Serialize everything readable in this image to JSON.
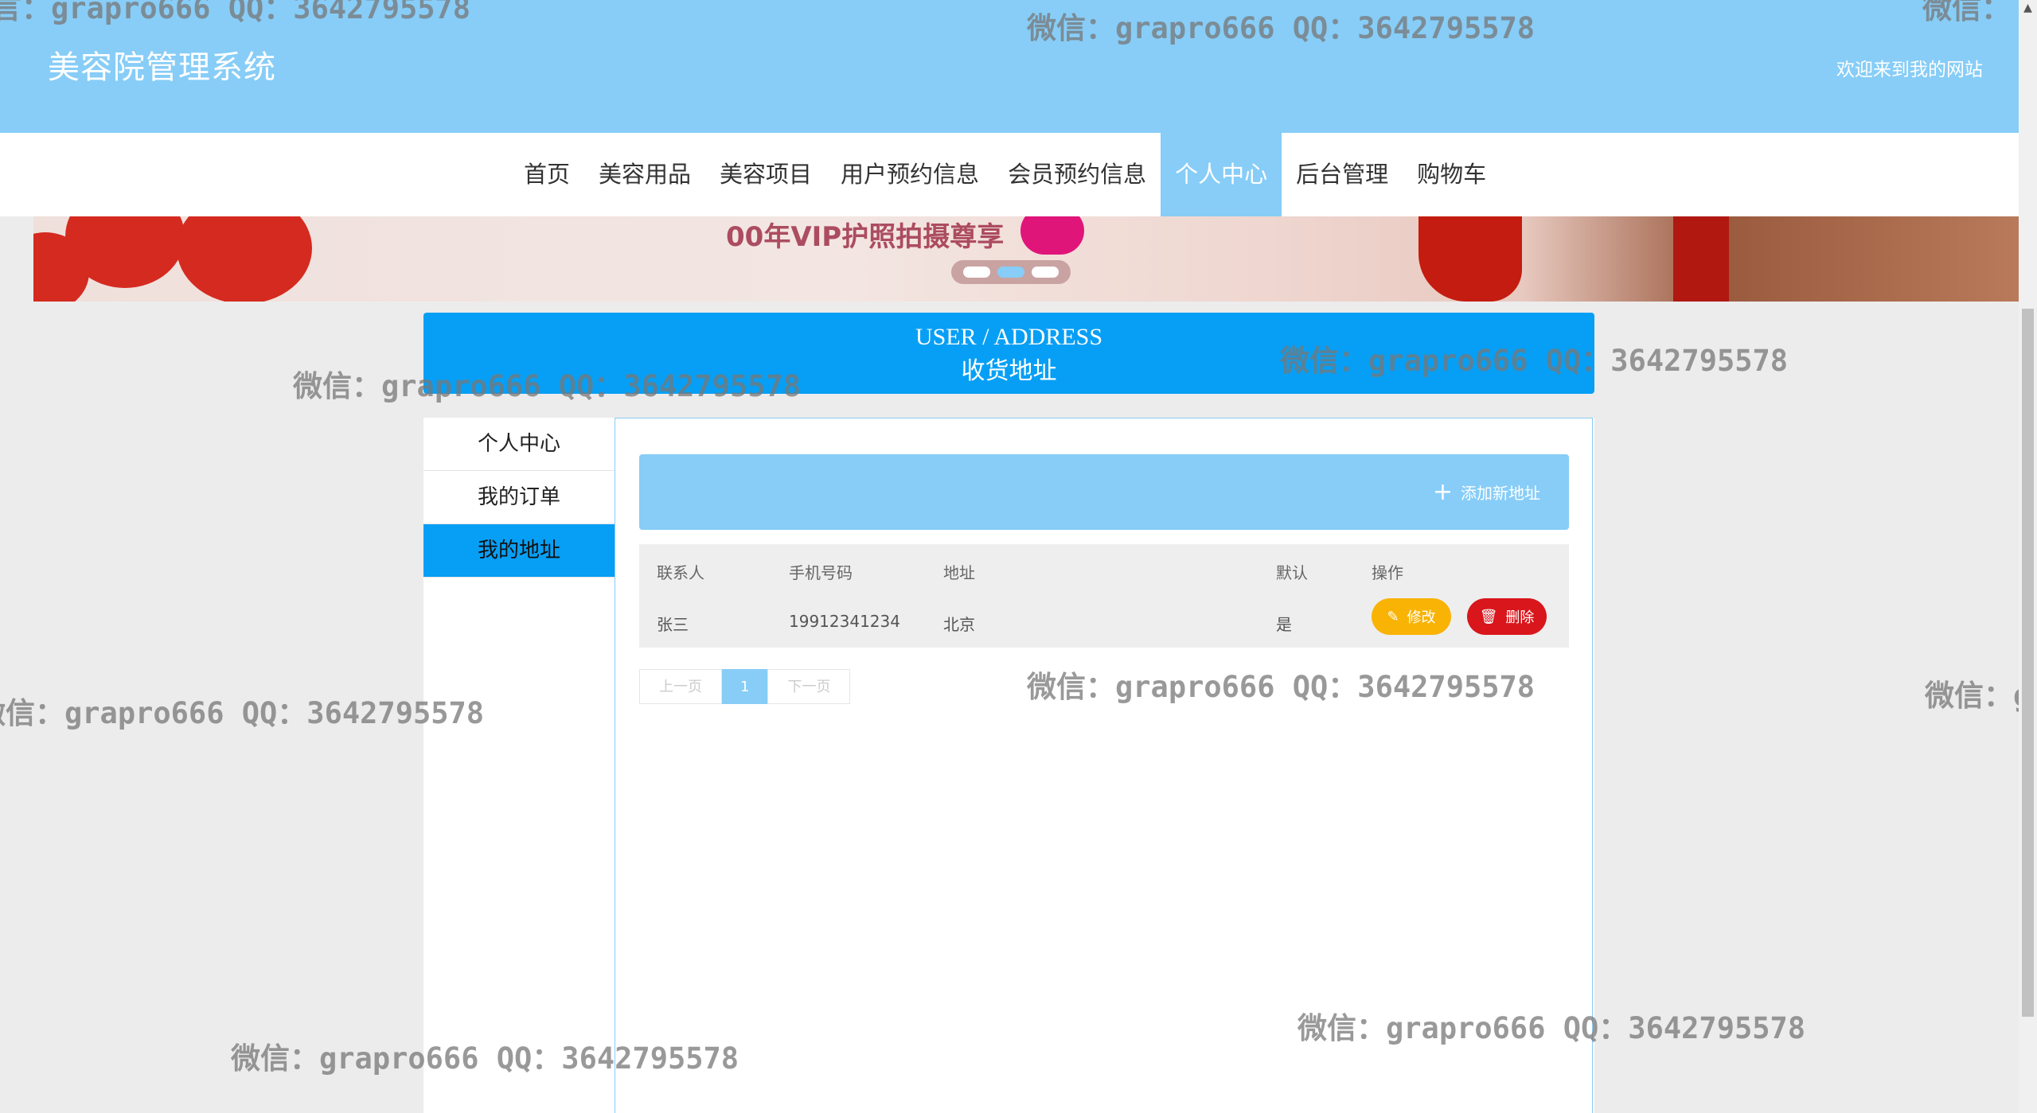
{
  "header": {
    "title": "美容院管理系统",
    "welcome": "欢迎来到我的网站"
  },
  "nav": {
    "items": [
      {
        "label": "首页"
      },
      {
        "label": "美容用品"
      },
      {
        "label": "美容项目"
      },
      {
        "label": "用户预约信息"
      },
      {
        "label": "会员预约信息"
      },
      {
        "label": "个人中心"
      },
      {
        "label": "后台管理"
      },
      {
        "label": "购物车"
      }
    ],
    "active": "个人中心"
  },
  "banner": {
    "text": "00年VIP护照拍摄尊享"
  },
  "section": {
    "title_en": "USER / ADDRESS",
    "title_cn": "收货地址"
  },
  "sidebar": {
    "items": [
      {
        "label": "个人中心"
      },
      {
        "label": "我的订单"
      },
      {
        "label": "我的地址"
      }
    ],
    "active": "我的地址"
  },
  "toolbar": {
    "add_label": "添加新地址"
  },
  "table": {
    "headers": [
      "联系人",
      "手机号码",
      "地址",
      "默认",
      "操作"
    ],
    "rows": [
      {
        "name": "张三",
        "phone": "19912341234",
        "address": "北京",
        "default": "是",
        "edit": "修改",
        "delete": "删除"
      }
    ]
  },
  "pager": {
    "prev": "上一页",
    "current": "1",
    "next": "下一页"
  },
  "watermark": {
    "text": "微信：grapro666 QQ：3642795578",
    "text_b": "微信：grapro666 QQ：3642795578",
    "text_partial_left": "言：grapro666 QQ：3642795578",
    "text_partial_left2": "微信：grapro666 QQ：3642795578",
    "text_partial_right": "微信：",
    "text_partial_right2": "微信：g"
  },
  "colors": {
    "header_bg": "#87cdf7",
    "section_bg": "#079ff5",
    "edit_btn": "#f9b305",
    "delete_btn": "#d8161c"
  }
}
